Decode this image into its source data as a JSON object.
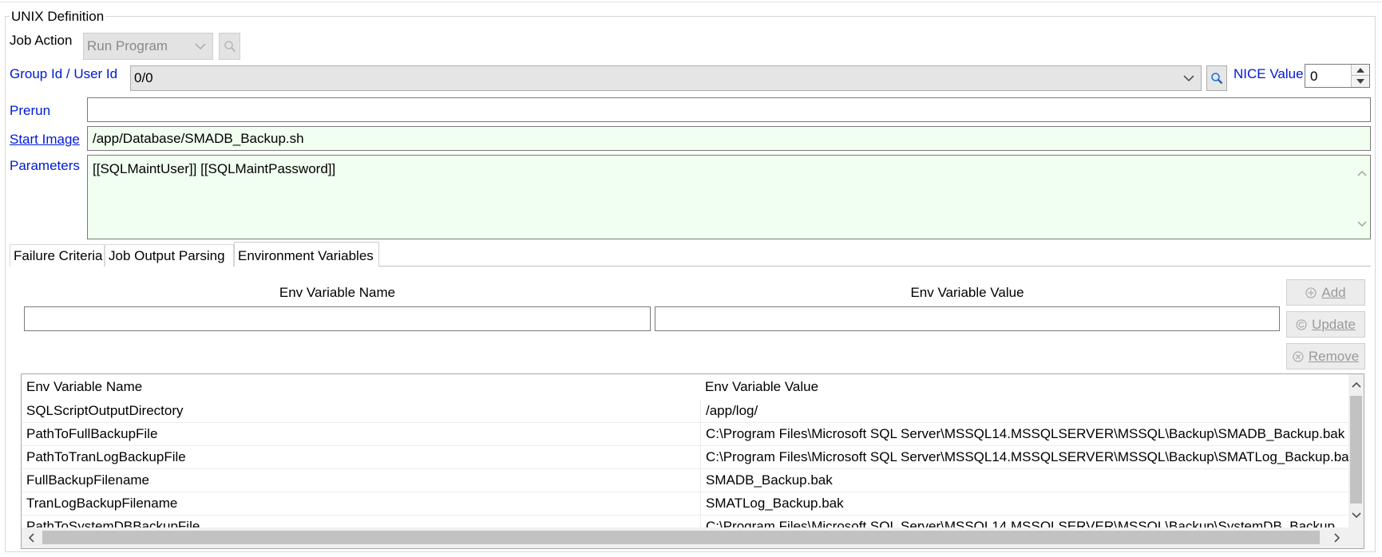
{
  "section": {
    "legend": "UNIX Definition"
  },
  "job_action": {
    "label": "Job Action",
    "value": "Run Program"
  },
  "group_user": {
    "label": "Group Id / User Id",
    "value": "0/0"
  },
  "nice": {
    "label": "NICE Value",
    "value": "0"
  },
  "prerun": {
    "label": "Prerun",
    "value": ""
  },
  "start_image": {
    "label": "Start Image",
    "value": "/app/Database/SMADB_Backup.sh"
  },
  "parameters": {
    "label": "Parameters",
    "value": "[[SQLMaintUser]] [[SQLMaintPassword]]"
  },
  "tabs": [
    {
      "label": "Failure Criteria"
    },
    {
      "label": "Job Output Parsing"
    },
    {
      "label": "Environment Variables",
      "selected": true
    }
  ],
  "env_editor": {
    "name_header": "Env Variable Name",
    "value_header": "Env Variable Value",
    "name_value": "",
    "value_value": ""
  },
  "buttons": {
    "add": "Add",
    "update": "Update",
    "remove": "Remove"
  },
  "table": {
    "columns": [
      "Env Variable Name",
      "Env Variable Value"
    ],
    "rows": [
      {
        "name": "SQLScriptOutputDirectory",
        "value": "/app/log/"
      },
      {
        "name": "PathToFullBackupFile",
        "value": "C:\\Program Files\\Microsoft SQL Server\\MSSQL14.MSSQLSERVER\\MSSQL\\Backup\\SMADB_Backup.bak"
      },
      {
        "name": "PathToTranLogBackupFile",
        "value": "C:\\Program Files\\Microsoft SQL Server\\MSSQL14.MSSQLSERVER\\MSSQL\\Backup\\SMATLog_Backup.bak"
      },
      {
        "name": "FullBackupFilename",
        "value": "SMADB_Backup.bak"
      },
      {
        "name": "TranLogBackupFilename",
        "value": "SMATLog_Backup.bak"
      },
      {
        "name": "PathToSystemDBBackupFile",
        "value": "C:\\Program Files\\Microsoft SQL Server\\MSSQL14.MSSQLSERVER\\MSSQL\\Backup\\SystemDB_Backup"
      }
    ]
  },
  "icons": {
    "search": "magnifier-icon",
    "dropdown": "chevron-down-icon",
    "add": "plus-circle-icon",
    "update": "refresh-circle-icon",
    "remove": "x-circle-icon"
  },
  "colors": {
    "label_blue": "#0018d8",
    "required_green": "#f0fff0"
  }
}
